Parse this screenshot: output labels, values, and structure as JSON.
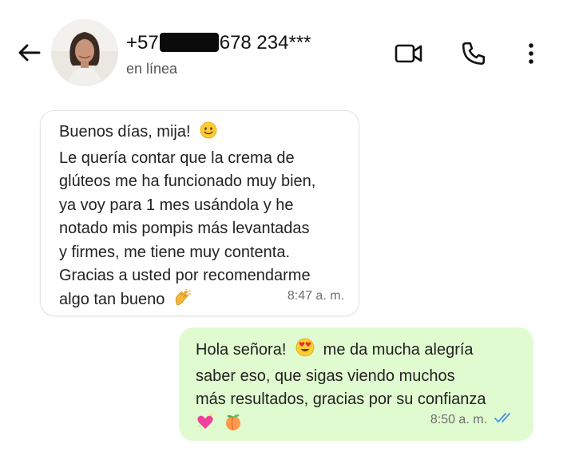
{
  "header": {
    "phone_prefix": "+57",
    "phone_suffix": "678 234***",
    "status": "en línea",
    "icons": [
      "back-arrow-icon",
      "video-call-icon",
      "phone-call-icon",
      "more-options-icon"
    ]
  },
  "colors": {
    "outgoing_bubble": "#e0fbd0",
    "incoming_bubble": "#ffffff",
    "read_ticks": "#4a90e2"
  },
  "messages": [
    {
      "direction": "incoming",
      "lines": [
        "Buenos días, mija!",
        "Le quería contar que la crema de",
        "glúteos me ha funcionado muy bien,",
        "ya voy para 1 mes usándola y he",
        "notado mis pompis más levantadas",
        "y firmes, me tiene muy contenta.",
        "Gracias a usted por recomendarme",
        "algo tan bueno"
      ],
      "emojis": [
        "smiling-face-emoji",
        "clapping-hands-emoji"
      ],
      "time": "8:47 a. m."
    },
    {
      "direction": "outgoing",
      "lines": [
        "Hola señora!",
        "me da mucha alegría",
        "saber eso, que sigas viendo muchos",
        "más resultados, gracias por su confianza"
      ],
      "emojis": [
        "heart-eyes-emoji",
        "sparkling-heart-emoji",
        "peach-emoji"
      ],
      "time": "8:50 a. m.",
      "read": true
    }
  ]
}
